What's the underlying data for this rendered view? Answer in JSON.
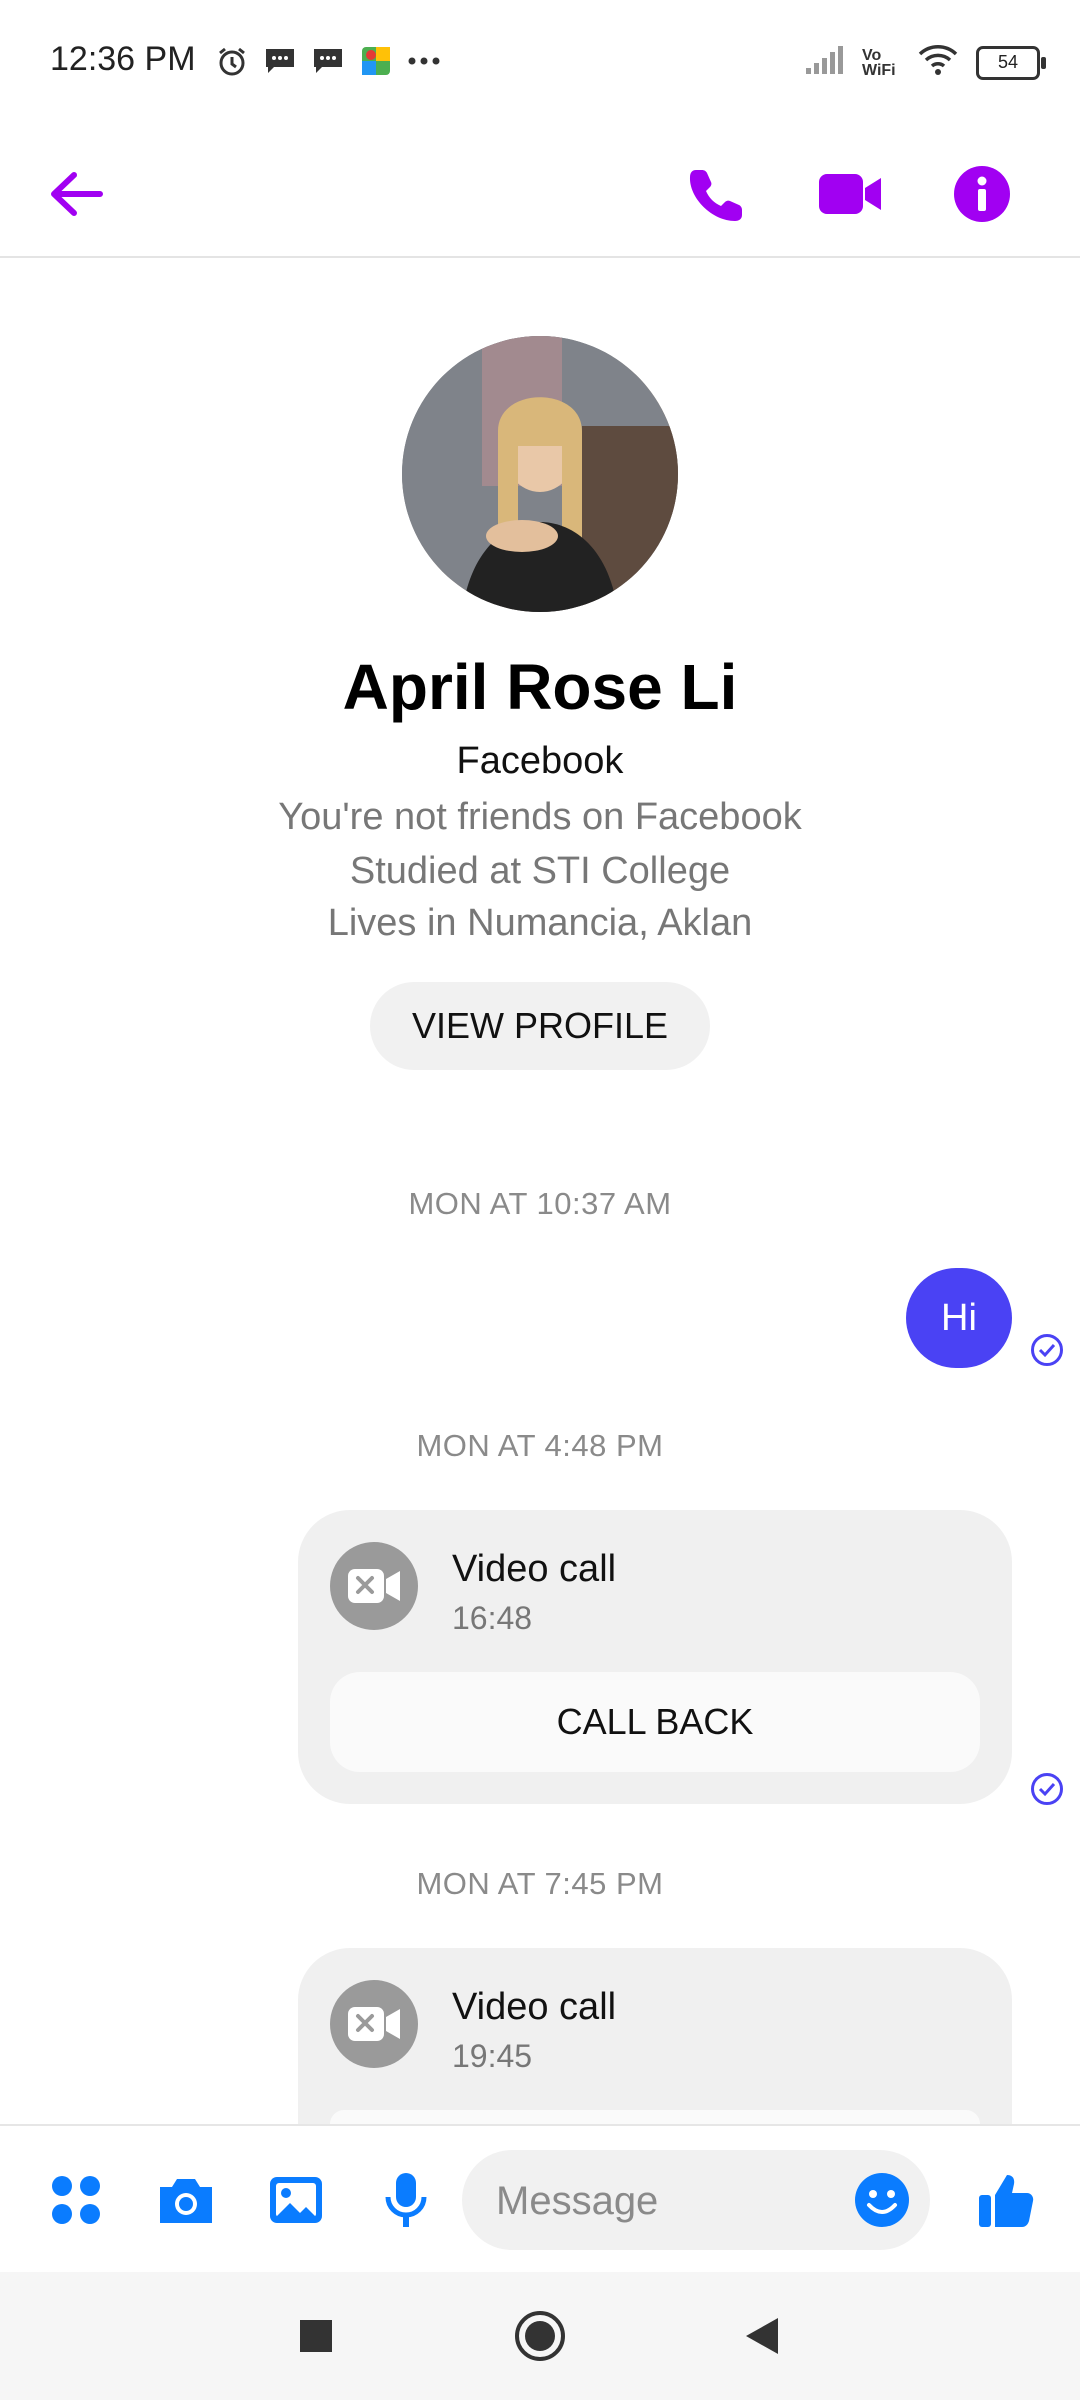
{
  "status_bar": {
    "time": "12:36 PM",
    "left_icons": [
      "alarm-icon",
      "message-icon",
      "message-icon",
      "maps-icon",
      "more-dots-icon"
    ],
    "right_icons": [
      "signal-icon",
      "vowifi-icon",
      "wifi-icon"
    ],
    "vowifi_label": "Vo WiFi",
    "battery": "54"
  },
  "header": {
    "accent_color": "#a100f2",
    "back_icon": "arrow-left-icon",
    "actions": [
      "phone-icon",
      "video-camera-icon",
      "info-icon"
    ]
  },
  "profile": {
    "name": "April Rose Li",
    "source": "Facebook",
    "details": [
      "You're not friends on Facebook",
      "Studied at STI College",
      "Lives in Numancia, Aklan"
    ],
    "view_profile_label": "VIEW PROFILE"
  },
  "messages": [
    {
      "timestamp": "MON AT 10:37 AM",
      "type": "text",
      "text": "Hi",
      "bubble_color": "#4a42f4"
    },
    {
      "timestamp": "MON AT 4:48 PM",
      "type": "call",
      "title": "Video call",
      "time": "16:48",
      "action": "CALL BACK"
    },
    {
      "timestamp": "MON AT 7:45 PM",
      "type": "call",
      "title": "Video call",
      "time": "19:45"
    }
  ],
  "composer": {
    "accent_color": "#0a7cff",
    "icons": [
      "apps-icon",
      "camera-icon",
      "gallery-icon",
      "microphone-icon"
    ],
    "placeholder": "Message",
    "emoji_icon": "emoji-icon",
    "like_icon": "thumbs-up-icon"
  },
  "nav_bar": [
    "square-icon",
    "home-circle-icon",
    "back-triangle-icon"
  ]
}
